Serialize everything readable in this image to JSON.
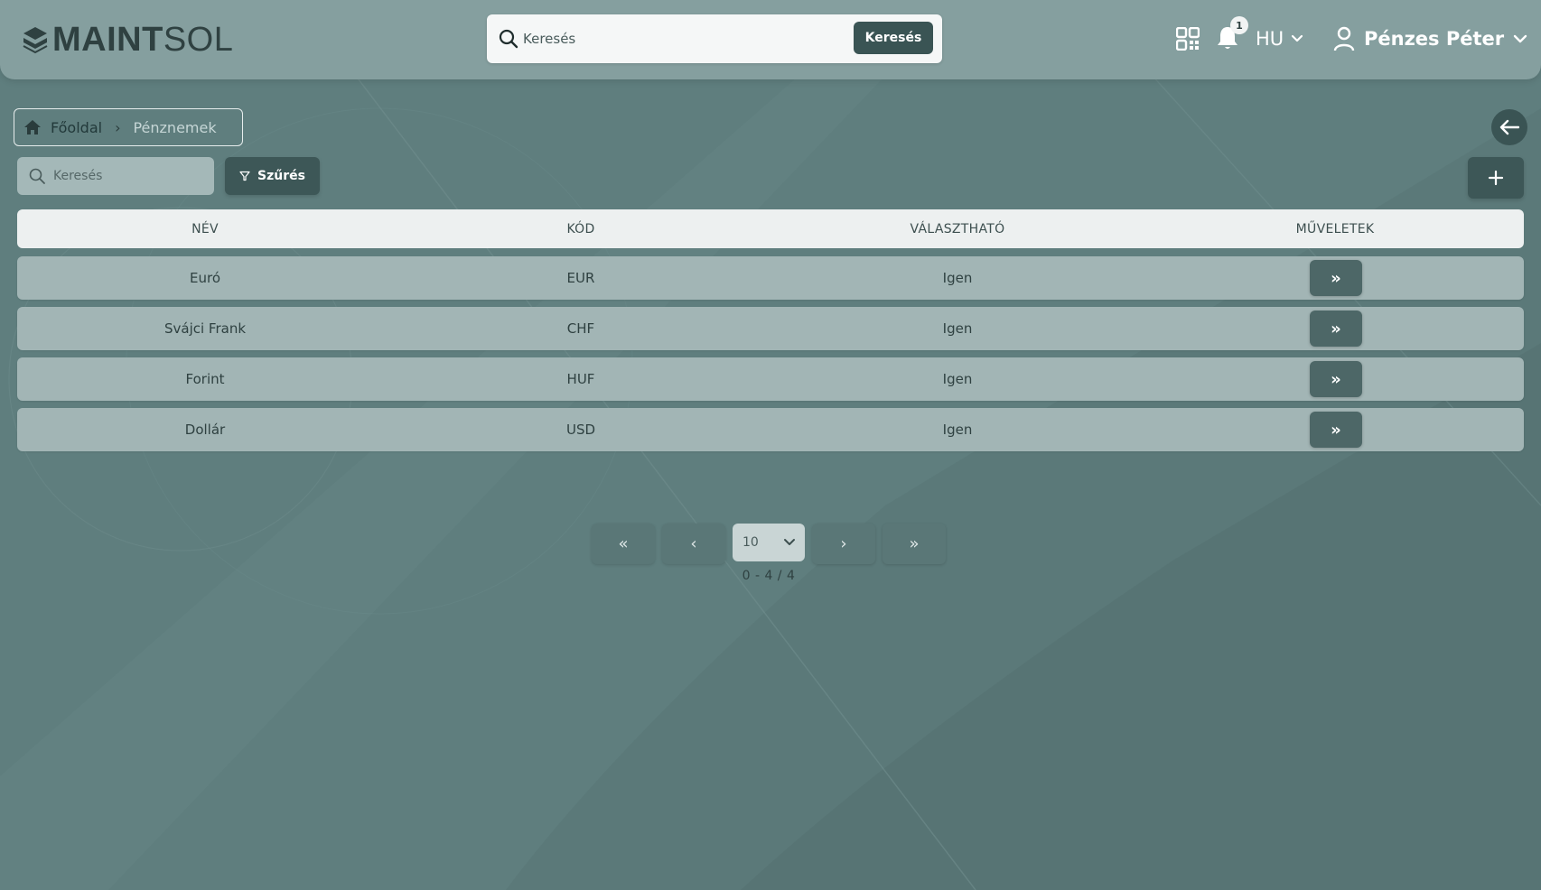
{
  "app": {
    "logo_bold": "MAINT",
    "logo_light": "SOL"
  },
  "header": {
    "search_placeholder": "Keresés",
    "search_button": "Keresés",
    "notification_count": "1",
    "language": "HU",
    "user_name": "Pénzes Péter"
  },
  "breadcrumb": {
    "home": "Főoldal",
    "separator": "›",
    "current": "Pénznemek"
  },
  "toolbar": {
    "search_placeholder": "Keresés",
    "filter_label": "Szűrés",
    "add_label": "+"
  },
  "table": {
    "columns": [
      "NÉV",
      "KÓD",
      "VÁLASZTHATÓ",
      "MŰVELETEK"
    ],
    "rows": [
      {
        "name": "Euró",
        "code": "EUR",
        "selectable": "Igen",
        "action": "»"
      },
      {
        "name": "Svájci Frank",
        "code": "CHF",
        "selectable": "Igen",
        "action": "»"
      },
      {
        "name": "Forint",
        "code": "HUF",
        "selectable": "Igen",
        "action": "»"
      },
      {
        "name": "Dollár",
        "code": "USD",
        "selectable": "Igen",
        "action": "»"
      }
    ]
  },
  "pagination": {
    "first": "«",
    "prev": "‹",
    "page_size": "10",
    "next": "›",
    "last": "»",
    "info": "0 - 4 / 4"
  },
  "colors": {
    "background": "#5f7e7e",
    "header": "#859f9f",
    "accent_dark": "#3a5454",
    "row": "#a2b5b5",
    "table_head": "#edf0f0"
  }
}
